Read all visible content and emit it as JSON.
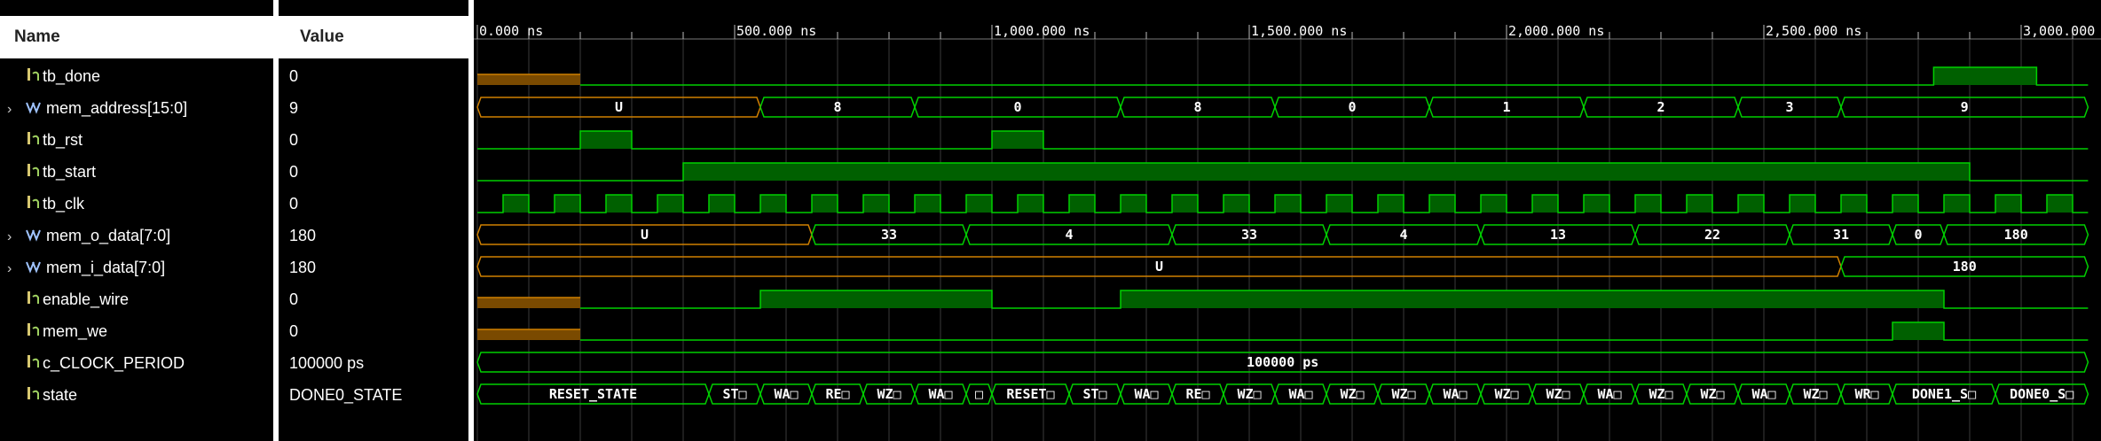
{
  "columns": {
    "name": "Name",
    "value": "Value"
  },
  "signals": [
    {
      "name": "tb_done",
      "value": "0",
      "kind": "bit"
    },
    {
      "name": "mem_address[15:0]",
      "value": "9",
      "kind": "bus"
    },
    {
      "name": "tb_rst",
      "value": "0",
      "kind": "bit"
    },
    {
      "name": "tb_start",
      "value": "0",
      "kind": "bit"
    },
    {
      "name": "tb_clk",
      "value": "0",
      "kind": "bit"
    },
    {
      "name": "mem_o_data[7:0]",
      "value": "180",
      "kind": "bus"
    },
    {
      "name": "mem_i_data[7:0]",
      "value": "180",
      "kind": "bus"
    },
    {
      "name": "enable_wire",
      "value": "0",
      "kind": "bit"
    },
    {
      "name": "mem_we",
      "value": "0",
      "kind": "bit"
    },
    {
      "name": "c_CLOCK_PERIOD",
      "value": "100000 ps",
      "kind": "const"
    },
    {
      "name": "state",
      "value": "DONE0_STATE",
      "kind": "enum"
    }
  ],
  "ruler": {
    "labels": [
      "0.000 ns",
      "500.000 ns",
      "1,000.000 ns",
      "1,500.000 ns",
      "2,000.000 ns",
      "2,500.000 ns",
      "3,000.000"
    ],
    "label_times_ns": [
      0,
      500,
      1000,
      1500,
      2000,
      2500,
      3000
    ]
  },
  "timeline": {
    "ns_start": 0,
    "ns_end": 3130,
    "clock_period_ns": 100
  },
  "colors": {
    "trace": "#00d000",
    "fill": "#006000",
    "undefined_fill": "#7a4a00",
    "undefined_stroke": "#d08000",
    "grid": "#3a3a3a"
  },
  "waves": {
    "tb_done": {
      "type": "bit",
      "undef_until": 200,
      "highs": [
        [
          2830,
          3030
        ]
      ]
    },
    "tb_rst": {
      "type": "bit",
      "highs": [
        [
          200,
          300
        ],
        [
          1000,
          1100
        ]
      ]
    },
    "tb_start": {
      "type": "bit",
      "highs": [
        [
          400,
          2900
        ]
      ]
    },
    "tb_clk": {
      "type": "clock",
      "first_high": 50,
      "half_period": 50
    },
    "enable_wire": {
      "type": "bit",
      "undef_until": 200,
      "highs": [
        [
          550,
          1000
        ],
        [
          1250,
          2850
        ]
      ]
    },
    "mem_we": {
      "type": "bit",
      "undef_until": 200,
      "highs": [
        [
          2750,
          2850
        ]
      ]
    },
    "mem_address": {
      "type": "bus",
      "segments": [
        {
          "t0": 0,
          "t1": 550,
          "v": "U",
          "undef": true
        },
        {
          "t0": 550,
          "t1": 850,
          "v": "8"
        },
        {
          "t0": 850,
          "t1": 1250,
          "v": "0"
        },
        {
          "t0": 1250,
          "t1": 1550,
          "v": "8"
        },
        {
          "t0": 1550,
          "t1": 1850,
          "v": "0"
        },
        {
          "t0": 1850,
          "t1": 2150,
          "v": "1"
        },
        {
          "t0": 2150,
          "t1": 2450,
          "v": "2"
        },
        {
          "t0": 2450,
          "t1": 2650,
          "v": "3"
        },
        {
          "t0": 2650,
          "t1": 3130,
          "v": "9"
        }
      ]
    },
    "mem_o_data": {
      "type": "bus",
      "segments": [
        {
          "t0": 0,
          "t1": 650,
          "v": "U",
          "undef": true
        },
        {
          "t0": 650,
          "t1": 950,
          "v": "33"
        },
        {
          "t0": 950,
          "t1": 1350,
          "v": "4"
        },
        {
          "t0": 1350,
          "t1": 1650,
          "v": "33"
        },
        {
          "t0": 1650,
          "t1": 1950,
          "v": "4"
        },
        {
          "t0": 1950,
          "t1": 2250,
          "v": "13"
        },
        {
          "t0": 2250,
          "t1": 2550,
          "v": "22"
        },
        {
          "t0": 2550,
          "t1": 2750,
          "v": "31"
        },
        {
          "t0": 2750,
          "t1": 2850,
          "v": "0"
        },
        {
          "t0": 2850,
          "t1": 3130,
          "v": "180"
        }
      ]
    },
    "mem_i_data": {
      "type": "bus",
      "segments": [
        {
          "t0": 0,
          "t1": 2650,
          "v": "U",
          "undef": true
        },
        {
          "t0": 2650,
          "t1": 3130,
          "v": "180"
        }
      ]
    },
    "c_CLOCK_PERIOD": {
      "type": "bus",
      "segments": [
        {
          "t0": 0,
          "t1": 3130,
          "v": "100000 ps"
        }
      ]
    },
    "state": {
      "type": "bus",
      "segments": [
        {
          "t0": 0,
          "t1": 450,
          "v": "RESET_STATE"
        },
        {
          "t0": 450,
          "t1": 550,
          "v": "ST□"
        },
        {
          "t0": 550,
          "t1": 650,
          "v": "WA□"
        },
        {
          "t0": 650,
          "t1": 750,
          "v": "RE□"
        },
        {
          "t0": 750,
          "t1": 850,
          "v": "WZ□"
        },
        {
          "t0": 850,
          "t1": 950,
          "v": "WA□"
        },
        {
          "t0": 950,
          "t1": 1000,
          "v": "□"
        },
        {
          "t0": 1000,
          "t1": 1150,
          "v": "RESET□"
        },
        {
          "t0": 1150,
          "t1": 1250,
          "v": "ST□"
        },
        {
          "t0": 1250,
          "t1": 1350,
          "v": "WA□"
        },
        {
          "t0": 1350,
          "t1": 1450,
          "v": "RE□"
        },
        {
          "t0": 1450,
          "t1": 1550,
          "v": "WZ□"
        },
        {
          "t0": 1550,
          "t1": 1650,
          "v": "WA□"
        },
        {
          "t0": 1650,
          "t1": 1750,
          "v": "WZ□"
        },
        {
          "t0": 1750,
          "t1": 1850,
          "v": "WZ□"
        },
        {
          "t0": 1850,
          "t1": 1950,
          "v": "WA□"
        },
        {
          "t0": 1950,
          "t1": 2050,
          "v": "WZ□"
        },
        {
          "t0": 2050,
          "t1": 2150,
          "v": "WZ□"
        },
        {
          "t0": 2150,
          "t1": 2250,
          "v": "WA□"
        },
        {
          "t0": 2250,
          "t1": 2350,
          "v": "WZ□"
        },
        {
          "t0": 2350,
          "t1": 2450,
          "v": "WZ□"
        },
        {
          "t0": 2450,
          "t1": 2550,
          "v": "WA□"
        },
        {
          "t0": 2550,
          "t1": 2650,
          "v": "WZ□"
        },
        {
          "t0": 2650,
          "t1": 2750,
          "v": "WR□"
        },
        {
          "t0": 2750,
          "t1": 2950,
          "v": "DONE1_S□"
        },
        {
          "t0": 2950,
          "t1": 3130,
          "v": "DONE0_S□"
        }
      ]
    }
  }
}
